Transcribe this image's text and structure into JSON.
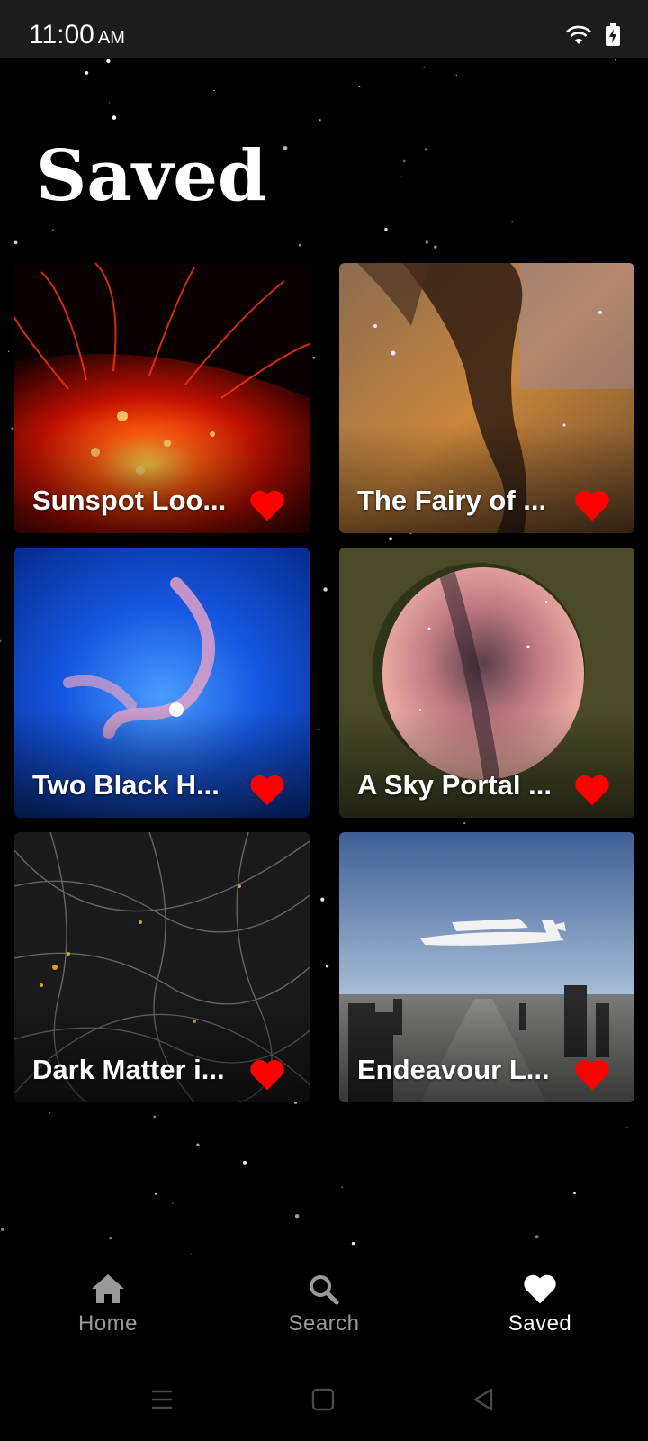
{
  "status_bar": {
    "time": "11:00",
    "ampm": "AM",
    "icons": [
      "wifi-icon",
      "battery-charging-icon"
    ]
  },
  "page_title": "Saved",
  "cards": [
    {
      "title": "Sunspot Loo...",
      "icon": "heart-icon",
      "favorite_color": "#ff0000"
    },
    {
      "title": "The Fairy of ...",
      "icon": "heart-icon",
      "favorite_color": "#ff0000"
    },
    {
      "title": "Two Black H...",
      "icon": "heart-icon",
      "favorite_color": "#ff0000"
    },
    {
      "title": "A Sky Portal ...",
      "icon": "heart-icon",
      "favorite_color": "#ff0000"
    },
    {
      "title": "Dark Matter i...",
      "icon": "heart-icon",
      "favorite_color": "#ff0000"
    },
    {
      "title": "Endeavour L...",
      "icon": "heart-icon",
      "favorite_color": "#ff0000"
    }
  ],
  "bottom_nav": [
    {
      "label": "Home",
      "icon": "home-icon",
      "active": false
    },
    {
      "label": "Search",
      "icon": "search-icon",
      "active": false
    },
    {
      "label": "Saved",
      "icon": "heart-icon",
      "active": true
    }
  ],
  "system_nav": [
    "menu-icon",
    "home-square-icon",
    "back-triangle-icon"
  ],
  "colors": {
    "background": "#000000",
    "accent_heart": "#ff0000",
    "nav_inactive": "#9a9a9a",
    "nav_active": "#ffffff"
  }
}
